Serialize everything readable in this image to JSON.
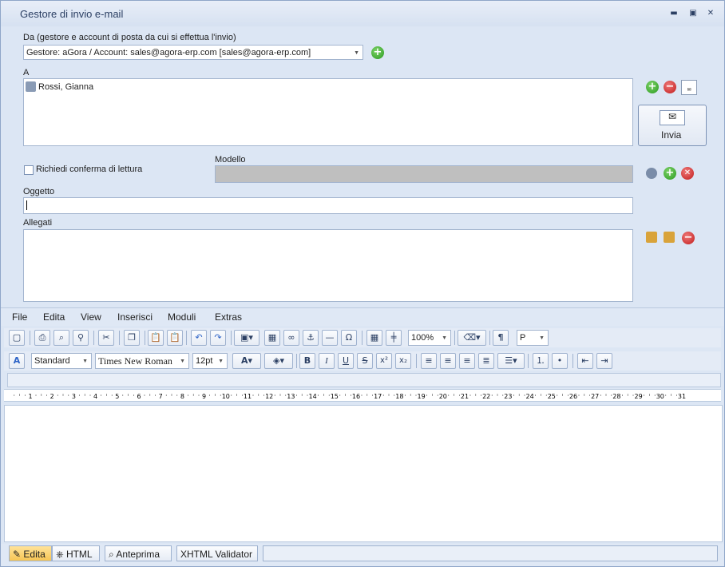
{
  "window": {
    "title": "Gestore di invio e-mail"
  },
  "from": {
    "label": "Da (gestore e account di posta da cui si effettua l'invio)",
    "value": "Gestore: aGora / Account: sales@agora-erp.com [sales@agora-erp.com]"
  },
  "to": {
    "label": "A",
    "recipient": "Rossi, Gianna"
  },
  "send": {
    "label": "Invia"
  },
  "read_receipt": {
    "label": "Richiedi conferma di lettura"
  },
  "template": {
    "label": "Modello"
  },
  "subject": {
    "label": "Oggetto",
    "value": ""
  },
  "attachments": {
    "label": "Allegati"
  },
  "menu": {
    "items": [
      "File",
      "Edita",
      "View",
      "Inserisci",
      "Moduli",
      "Extras"
    ]
  },
  "toolbar": {
    "zoom": "100%",
    "para": "P",
    "style": "Standard",
    "font": "Times New Roman",
    "size": "12pt"
  },
  "ruler": {
    "numbers": [
      "1",
      "2",
      "3",
      "4",
      "5",
      "6",
      "7",
      "8",
      "9",
      "10",
      "11",
      "12",
      "13",
      "14",
      "15",
      "16",
      "17",
      "18",
      "19",
      "20",
      "21",
      "22",
      "23",
      "24",
      "25",
      "26",
      "27",
      "28",
      "29",
      "30",
      "31"
    ]
  },
  "bottom_tabs": {
    "edit": "Edita",
    "html": "HTML",
    "preview": "Anteprima",
    "validator": "XHTML Validator"
  },
  "colors": {
    "accent": "#2a9a1e",
    "danger": "#c01a1a",
    "active_tab": "#f7c553"
  }
}
